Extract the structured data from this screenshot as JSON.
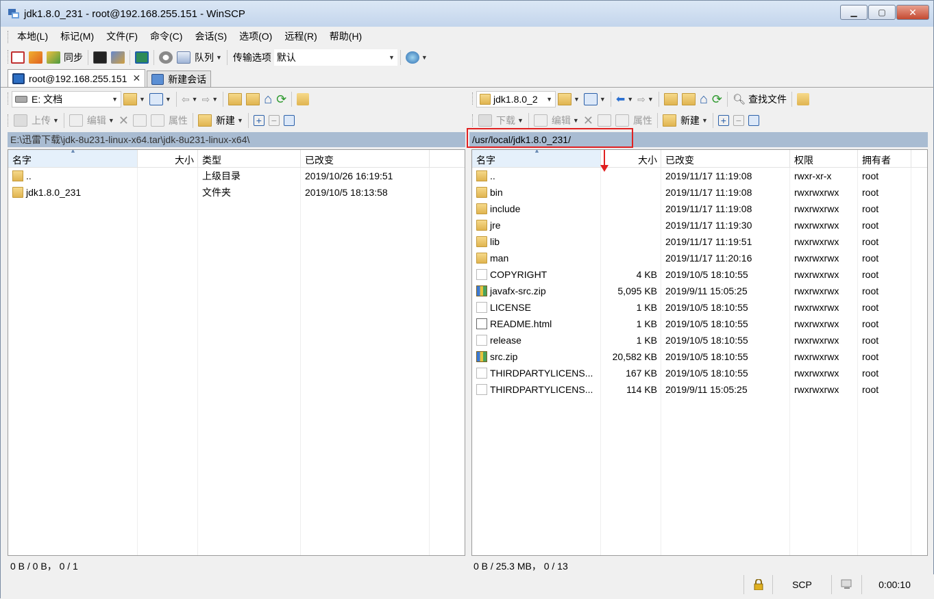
{
  "window": {
    "title": "jdk1.8.0_231 - root@192.168.255.151 - WinSCP"
  },
  "menu": [
    "本地(L)",
    "标记(M)",
    "文件(F)",
    "命令(C)",
    "会话(S)",
    "选项(O)",
    "远程(R)",
    "帮助(H)"
  ],
  "toolbar": {
    "sync_label": "同步",
    "queue_label": "队列",
    "transfer_label": "传输选项",
    "transfer_value": "默认"
  },
  "tabs": {
    "session": "root@192.168.255.151",
    "new_session": "新建会话"
  },
  "local": {
    "drive": "E: 文档",
    "upload_label": "上传",
    "edit_label": "编辑",
    "props_label": "属性",
    "new_label": "新建",
    "path": "E:\\迅雷下载\\jdk-8u231-linux-x64.tar\\jdk-8u231-linux-x64\\",
    "headers": {
      "name": "名字",
      "size": "大小",
      "type": "类型",
      "changed": "已改变"
    },
    "files": [
      {
        "name": "..",
        "size": "",
        "type": "上级目录",
        "changed": "2019/10/26  16:19:51",
        "icon": "updir-icon"
      },
      {
        "name": "jdk1.8.0_231",
        "size": "",
        "type": "文件夹",
        "changed": "2019/10/5  18:13:58",
        "icon": "folder-icon"
      }
    ],
    "status": "0 B / 0 B， 0 / 1"
  },
  "remote": {
    "dir": "jdk1.8.0_2",
    "find_label": "查找文件",
    "download_label": "下载",
    "edit_label": "编辑",
    "props_label": "属性",
    "new_label": "新建",
    "path": "/usr/local/jdk1.8.0_231/",
    "headers": {
      "name": "名字",
      "size": "大小",
      "changed": "已改变",
      "rights": "权限",
      "owner": "拥有者"
    },
    "files": [
      {
        "name": "..",
        "size": "",
        "changed": "2019/11/17 11:19:08",
        "rights": "rwxr-xr-x",
        "owner": "root",
        "icon": "updir-icon"
      },
      {
        "name": "bin",
        "size": "",
        "changed": "2019/11/17 11:19:08",
        "rights": "rwxrwxrwx",
        "owner": "root",
        "icon": "folder-icon"
      },
      {
        "name": "include",
        "size": "",
        "changed": "2019/11/17 11:19:08",
        "rights": "rwxrwxrwx",
        "owner": "root",
        "icon": "folder-icon"
      },
      {
        "name": "jre",
        "size": "",
        "changed": "2019/11/17 11:19:30",
        "rights": "rwxrwxrwx",
        "owner": "root",
        "icon": "folder-icon"
      },
      {
        "name": "lib",
        "size": "",
        "changed": "2019/11/17 11:19:51",
        "rights": "rwxrwxrwx",
        "owner": "root",
        "icon": "folder-icon"
      },
      {
        "name": "man",
        "size": "",
        "changed": "2019/11/17 11:20:16",
        "rights": "rwxrwxrwx",
        "owner": "root",
        "icon": "folder-icon"
      },
      {
        "name": "COPYRIGHT",
        "size": "4 KB",
        "changed": "2019/10/5 18:10:55",
        "rights": "rwxrwxrwx",
        "owner": "root",
        "icon": "file-icon"
      },
      {
        "name": "javafx-src.zip",
        "size": "5,095 KB",
        "changed": "2019/9/11 15:05:25",
        "rights": "rwxrwxrwx",
        "owner": "root",
        "icon": "zip-icon"
      },
      {
        "name": "LICENSE",
        "size": "1 KB",
        "changed": "2019/10/5 18:10:55",
        "rights": "rwxrwxrwx",
        "owner": "root",
        "icon": "file-icon"
      },
      {
        "name": "README.html",
        "size": "1 KB",
        "changed": "2019/10/5 18:10:55",
        "rights": "rwxrwxrwx",
        "owner": "root",
        "icon": "html-icon"
      },
      {
        "name": "release",
        "size": "1 KB",
        "changed": "2019/10/5 18:10:55",
        "rights": "rwxrwxrwx",
        "owner": "root",
        "icon": "file-icon"
      },
      {
        "name": "src.zip",
        "size": "20,582 KB",
        "changed": "2019/10/5 18:10:55",
        "rights": "rwxrwxrwx",
        "owner": "root",
        "icon": "zip-icon"
      },
      {
        "name": "THIRDPARTYLICENS...",
        "size": "167 KB",
        "changed": "2019/10/5 18:10:55",
        "rights": "rwxrwxrwx",
        "owner": "root",
        "icon": "file-icon"
      },
      {
        "name": "THIRDPARTYLICENS...",
        "size": "114 KB",
        "changed": "2019/9/11 15:05:25",
        "rights": "rwxrwxrwx",
        "owner": "root",
        "icon": "file-icon"
      }
    ],
    "status": "0 B / 25.3 MB， 0 / 13"
  },
  "statusbar": {
    "protocol": "SCP",
    "time": "0:00:10"
  },
  "colors": {
    "path_bar": "#a9bcd2",
    "highlight": "#e02020"
  }
}
